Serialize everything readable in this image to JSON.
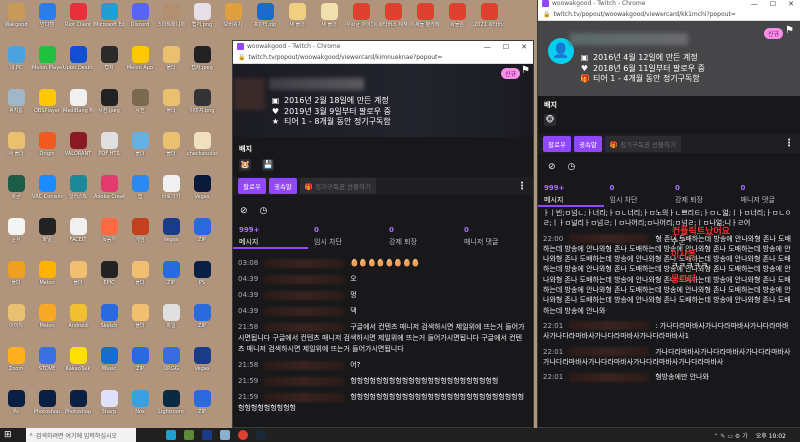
{
  "desktop": {
    "left_icons": [
      {
        "label": "Wakgood",
        "color": "#c79a5a"
      },
      {
        "label": "내 PC",
        "color": "#4aa3e0"
      },
      {
        "label": "휴지통",
        "color": "#9fb7c9"
      },
      {
        "label": "새 폴더",
        "color": "#e8c070"
      },
      {
        "label": "왁굳",
        "color": "#1d5c49"
      },
      {
        "label": "문서",
        "color": "#f4f4f4"
      },
      {
        "label": "폴더",
        "color": "#f0a020"
      },
      {
        "label": "이미지",
        "color": "#e8c070"
      },
      {
        "label": "Zoom",
        "color": "#ffb020"
      },
      {
        "label": "Ps",
        "color": "#0a1f44"
      },
      {
        "label": "반디캠",
        "color": "#2b7de9"
      },
      {
        "label": "Melon Player",
        "color": "#20c040"
      },
      {
        "label": "OBSPlayer",
        "color": "#ffc800"
      },
      {
        "label": "Origin",
        "color": "#f05a22"
      },
      {
        "label": "VRC Console",
        "color": "#1a8cff"
      },
      {
        "label": "파일",
        "color": "#222222"
      },
      {
        "label": "Melon",
        "color": "#ffb300"
      },
      {
        "label": "Melon",
        "color": "#f9a825"
      },
      {
        "label": "STOVE",
        "color": "#3a70e0"
      },
      {
        "label": "Photoshop",
        "color": "#0a1f44"
      },
      {
        "label": "Riot Client",
        "color": "#e8303a"
      },
      {
        "label": "Upbit Desktop",
        "color": "#1050d0"
      },
      {
        "label": "MediBang Paint Pro",
        "color": "#f0f0f0"
      },
      {
        "label": "VALORANT",
        "color": "#8a1a24"
      },
      {
        "label": "일러스트",
        "color": "#1a8a9a"
      },
      {
        "label": "FACEIT",
        "color": "#f0f0f0"
      },
      {
        "label": "폴더",
        "color": "#f0c070"
      },
      {
        "label": "Android",
        "color": "#f0c030"
      },
      {
        "label": "KakaoTalk",
        "color": "#ffe000"
      },
      {
        "label": "Photoshop",
        "color": "#0a1f44"
      },
      {
        "label": "Microsoft Edge",
        "color": "#1fa0d0"
      },
      {
        "label": "캡처",
        "color": "#2a2a2a"
      },
      {
        "label": "사진.jpeg",
        "color": "#222222"
      },
      {
        "label": "PDF HTS",
        "color": "#e0e0e0"
      },
      {
        "label": "Adobe Creative",
        "color": "#e33a6f"
      },
      {
        "label": "녹음기",
        "color": "#ff6a40"
      },
      {
        "label": "EPIC",
        "color": "#222222"
      },
      {
        "label": "Sketch",
        "color": "#2a6adf"
      },
      {
        "label": "Music",
        "color": "#1a6ad0"
      },
      {
        "label": "Sharp",
        "color": "#e0e0ff"
      },
      {
        "label": "Discord",
        "color": "#5865f2"
      },
      {
        "label": "Melon App",
        "color": "#ffc800"
      },
      {
        "label": "사진",
        "color": "#7a6a50"
      },
      {
        "label": "폴더",
        "color": "#64b0e0"
      },
      {
        "label": "앱",
        "color": "#2a8af0"
      },
      {
        "label": "게임",
        "color": "#c04020"
      },
      {
        "label": "폴더",
        "color": "#f0c070"
      },
      {
        "label": "폴더",
        "color": "#f0c070"
      },
      {
        "label": "ZIP",
        "color": "#2a6adf"
      },
      {
        "label": "Nox",
        "color": "#3aa0e0"
      },
      {
        "label": "스마트매니저",
        "color": "#b09070"
      },
      {
        "label": "폴더",
        "color": "#e8c070"
      },
      {
        "label": "폴더",
        "color": "#e8c070"
      },
      {
        "label": "폴더",
        "color": "#e8c070"
      },
      {
        "label": "바로가기",
        "color": "#f0f0f0"
      },
      {
        "label": "Vegas",
        "color": "#1a3a8a"
      },
      {
        "label": "ZIP",
        "color": "#2a6adf"
      },
      {
        "label": "파일",
        "color": "#e0e0e0"
      },
      {
        "label": "OP.GG",
        "color": "#3a6ae0"
      },
      {
        "label": "Lightroom",
        "color": "#0a2a44"
      },
      {
        "label": "캡처.png",
        "color": "#e8e0e8"
      },
      {
        "label": "캡처.jpeg",
        "color": "#222222"
      },
      {
        "label": "이미지.png",
        "color": "#333333"
      },
      {
        "label": "checkstudio",
        "color": "#f0e0c0"
      },
      {
        "label": "Vegas",
        "color": "#0a1a3a"
      },
      {
        "label": "ZIP",
        "color": "#2a6adf"
      },
      {
        "label": "PS",
        "color": "#0a1f44"
      },
      {
        "label": "ZIP",
        "color": "#2a6adf"
      },
      {
        "label": "Vegas",
        "color": "#1a3a8a"
      },
      {
        "label": "ZIP",
        "color": "#2a6adf"
      }
    ],
    "top_icons": [
      {
        "label": "오버워치",
        "color": "#e0a040"
      },
      {
        "label": "프린터.zip",
        "color": "#1a6ad0"
      },
      {
        "label": "새 폴더",
        "color": "#f0d080"
      },
      {
        "label": "새 폴더",
        "color": "#f0e0b0"
      },
      {
        "label": "우왁굳 아이디어",
        "color": "#e04030"
      },
      {
        "label": "왁타버스 제작",
        "color": "#e04030"
      },
      {
        "label": "이세돌 팬카페",
        "color": "#e04030"
      },
      {
        "label": "왁물원",
        "color": "#e04030"
      },
      {
        "label": "2021 왁타버스",
        "color": "#e04030"
      }
    ]
  },
  "mid": {
    "title": "woowakgood - Twitch - Chrome",
    "url": "twitch.tv/popout/woowakgood/viewercard/kimnueknae?popout=",
    "new_badge": "신규",
    "created": "2016년 2월 18일에 만든 계정",
    "following": "2019년 3월 9일부터 팔로우 중",
    "sub": "티어 1 - 8개월 동안 정기구독함",
    "badges_label": "배지",
    "follow": "팔로우",
    "whisper": "귓속말",
    "gift": "정기구독권 선물하기",
    "stats": [
      {
        "n": "999+",
        "l": "메시지"
      },
      {
        "n": "0",
        "l": "임시 차단"
      },
      {
        "n": "0",
        "l": "강제 퇴장"
      },
      {
        "n": "0",
        "l": "매니저 댓글"
      }
    ],
    "chat": [
      {
        "t": "03:08",
        "m": "🥚🥚🥚🥚🥚🥚🥚🥚"
      },
      {
        "t": "04:39",
        "m": "오"
      },
      {
        "t": "04:39",
        "m": "멍"
      },
      {
        "t": "04:39",
        "m": "댁"
      },
      {
        "t": "21:58",
        "m": "구글에서 컨텐츠 매니저 검색하시면 제일위에 뜨는거 들어가시면됩니다 구글에서 컨텐츠 매니저 검색하시면 제일위에 뜨는거 들어가시면됩니다 구글에서 컨텐츠 매니저 검색하시면 제일위에 뜨는거 들어가시면됩니다"
      },
      {
        "t": "21:58",
        "m": "어?"
      },
      {
        "t": "21:59",
        "m": "헝헝헝헝헝헝헝헝헝헝헝헝헝헝헝헝헝헝헝헝헝헝헝"
      },
      {
        "t": "21:59",
        "m": "헝헝헝헝헝헝헝헝헝헝헝헝헝헝헝헝헝헝헝헝헝헝헝헝헝헝헝헝헝헝헝헝헝헝헝헝"
      }
    ]
  },
  "right": {
    "title": "woowakgood - Twitch - Chrome",
    "url": "twitch.tv/popout/woowakgood/viewercard/kk1mchi?popout=",
    "new_badge": "신규",
    "created": "2016년 4월 12일에 만든 계정",
    "following": "2018년 6월 11일부터 팔로우 중",
    "sub": "티어 1 - 4개월 동안 정기구독함",
    "badges_label": "배지",
    "follow": "팔로우",
    "whisper": "귓속말",
    "gift": "정기구독권 선물하기",
    "stats": [
      {
        "n": "999+",
        "l": "메시지"
      },
      {
        "n": "0",
        "l": "임시 차단"
      },
      {
        "n": "0",
        "l": "강제 퇴장"
      },
      {
        "n": "0",
        "l": "매니저 댓글"
      }
    ],
    "first_line": "ㅏㅣ빈;ㅁ넘ㄴ;ㅏ너리;ㅏㅁㄴ너리;ㅏㅁ노의ㅏㄴ쁘리ㅌ;ㅏㅁㄴ얾;ㅣㅏㅁ너리;ㅏㅁㄴㅇㄹ;ㅣㅏㅁ널리ㅏㅁ넘ㄹ;ㅣㅁ나어리;ㅁ나어리;ㅁ넘ㄹ;ㅣㅁ나얾;니ㅏㄹ어",
    "chat": [
      {
        "t": "22:00",
        "m": "형 존나 도배하는데 방송에 안나와형 존나 도배하는데 방송에 안나와형 존나 도배하는데 방송에 안나와형 존나 도배하는데 방송에 안나와형 존나 도배하는데 방송에 안나와형 존나 도배하는데 방송에 안나와형 존나 도배하는데 방송에 안나와형 존나 도배하는데 방송에 안나와형 존나 도배하는데 방송에 안나와형 존나 도배하는데 방송에 안나와형 존나 도배하는데 방송에 안나와형 존나 도배하는데 방송에 안나와형 존나 도배하는데 방송에 안나와형 존나 도배하는데 방송에 안나와형 존나 도배하는데 방송에 안나와형 존나 도배하는데 방송에 안나와형 존나 도배하는데 방송에 안나와"
      },
      {
        "t": "22:01",
        "m": ": 가나다라마바사가나다라마바사가나다라마바사가나다라마바사가나다라마바사가나다라마바사1"
      },
      {
        "t": "22:01",
        "m": "가나다라마바사가나다라마바사가나다라마바사가나다라마바사가나다라마바사가나다라마바사가나다라마바사"
      },
      {
        "t": "22:01",
        "m": "형방송에만 안나와"
      }
    ],
    "overlay_red": [
      "컨플릭트났어요",
      "이사봉",
      "뭉크티"
    ],
    "overlay_white": [
      "수군",
      "ㅋㅋㅋㅋㅋ"
    ]
  },
  "taskbar": {
    "search_placeholder": "검색하려면 여기에 입력하십시오",
    "time": "오후 10:02"
  },
  "colors": {
    "accent": "#9147ff",
    "new_badge": "#f78fe8",
    "avatar": "#00d2ee"
  }
}
